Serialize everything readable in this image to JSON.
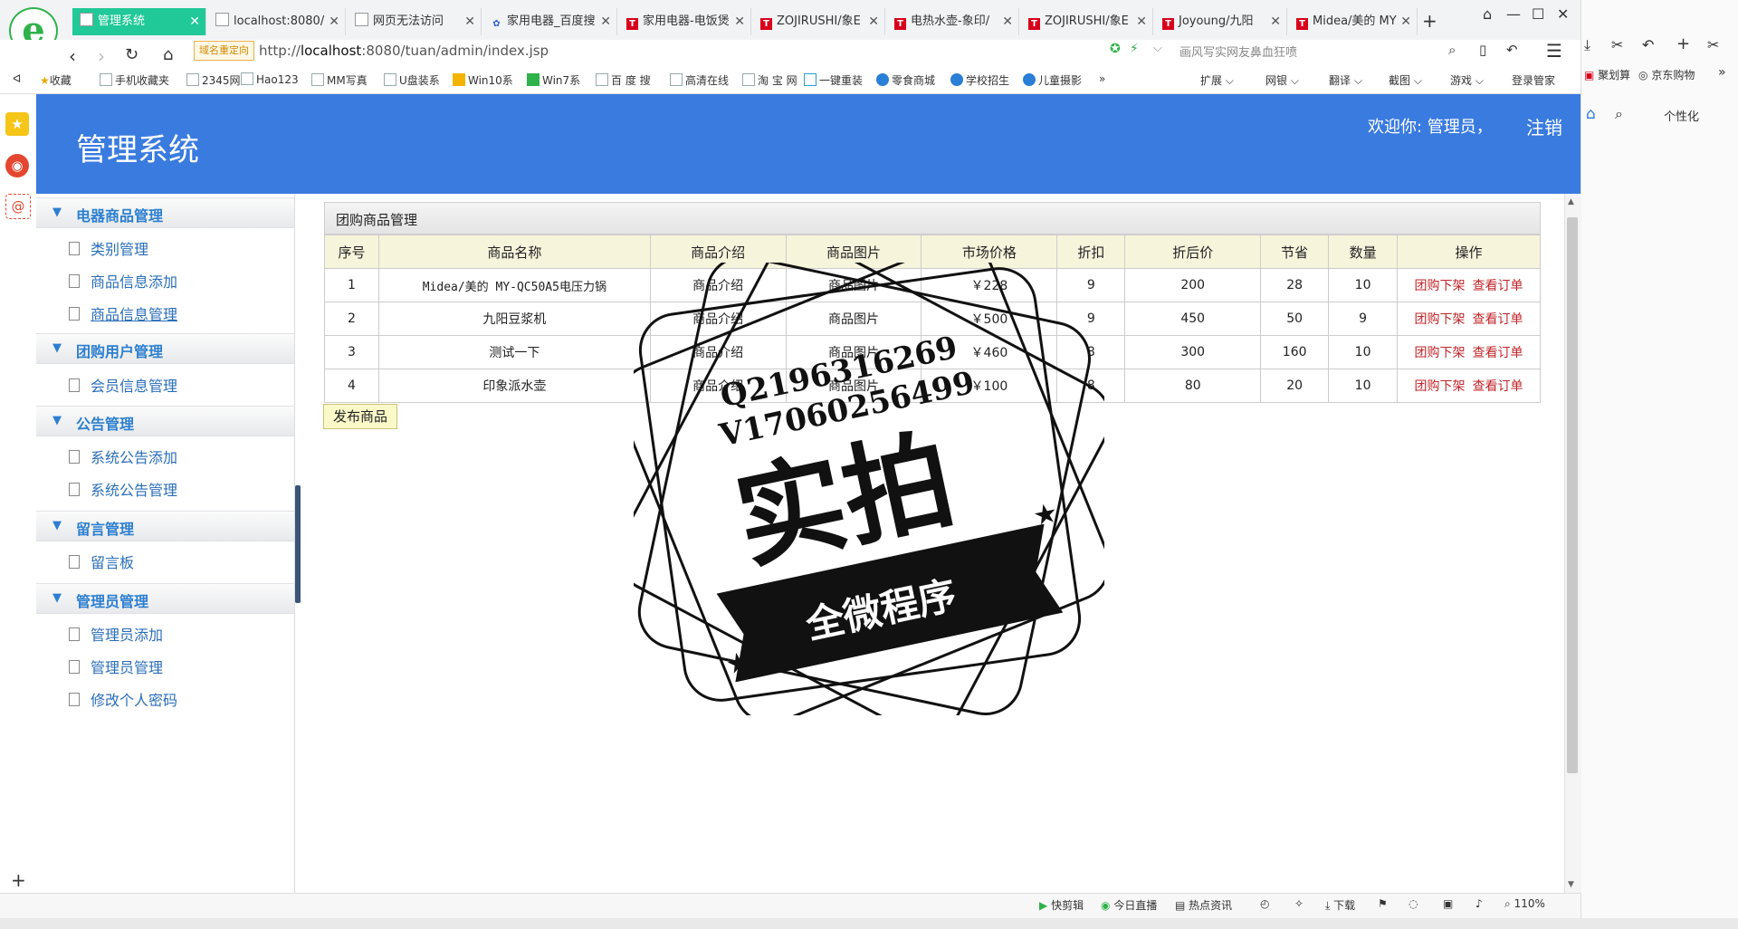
{
  "browser": {
    "tabs": [
      {
        "label": "管理系统",
        "active": true,
        "icon": "page-icon"
      },
      {
        "label": "localhost:8080/",
        "icon": "page-icon"
      },
      {
        "label": "网页无法访问",
        "icon": "page-icon"
      },
      {
        "label": "家用电器_百度搜",
        "icon": "baidu-icon"
      },
      {
        "label": "家用电器-电饭煲",
        "icon": "tmall-icon"
      },
      {
        "label": "ZOJIRUSHI/象E",
        "icon": "tmall-icon"
      },
      {
        "label": "电热水壶-象印/",
        "icon": "tmall-icon"
      },
      {
        "label": "ZOJIRUSHI/象E",
        "icon": "tmall-icon"
      },
      {
        "label": "Joyoung/九阳 ",
        "icon": "tmall-icon"
      },
      {
        "label": "Midea/美的 MY",
        "icon": "tmall-icon"
      }
    ],
    "redirect_badge": "域名重定向",
    "url_prefix": "http://",
    "url_host": "localhost",
    "url_rest": ":8080/tuan/admin/index.jsp",
    "search_placeholder": "画风写实网友鼻血狂喷",
    "bookmarks": [
      "收藏",
      "手机收藏夹",
      "2345网",
      "Hao123",
      "MM写真",
      "U盘装系",
      "Win10系",
      "Win7系",
      "百 度 搜",
      "高清在线",
      "淘 宝 网",
      "一键重装",
      "零食商城",
      "学校招生",
      "儿童摄影"
    ],
    "bookmark_tools": [
      "扩展",
      "网银",
      "翻译",
      "截图",
      "游戏",
      "登录管家"
    ],
    "right_panel": {
      "items": [
        "聚划算",
        "京东购物"
      ],
      "personalize": "个性化"
    },
    "status_items": [
      "快剪辑",
      "今日直播",
      "热点资讯",
      "下载"
    ],
    "zoom": "110%"
  },
  "app": {
    "title": "管理系统",
    "welcome": "欢迎你: 管理员，",
    "logout": "注销",
    "sidebar": [
      {
        "title": "电器商品管理",
        "items": [
          "类别管理",
          "商品信息添加",
          "商品信息管理"
        ]
      },
      {
        "title": "团购用户管理",
        "items": [
          "会员信息管理"
        ]
      },
      {
        "title": "公告管理",
        "items": [
          "系统公告添加",
          "系统公告管理"
        ]
      },
      {
        "title": "留言管理",
        "items": [
          "留言板"
        ]
      },
      {
        "title": "管理员管理",
        "items": [
          "管理员添加",
          "管理员管理",
          "修改个人密码"
        ]
      }
    ],
    "panel_title": "团购商品管理",
    "table": {
      "headers": [
        "序号",
        "商品名称",
        "商品介绍",
        "商品图片",
        "市场价格",
        "折扣",
        "折后价",
        "节省",
        "数量",
        "操作"
      ],
      "rows": [
        [
          "1",
          "Midea/美的 MY-QC50A5电压力锅",
          "商品介绍",
          "商品图片",
          "￥228",
          "9",
          "200",
          "28",
          "10"
        ],
        [
          "2",
          "九阳豆浆机",
          "商品介绍",
          "商品图片",
          "￥500",
          "9",
          "450",
          "50",
          "9"
        ],
        [
          "3",
          "测试一下",
          "商品介绍",
          "商品图片",
          "￥460",
          "8",
          "300",
          "160",
          "10"
        ],
        [
          "4",
          "印象派水壶",
          "商品介绍",
          "商品图片",
          "￥100",
          "8",
          "80",
          "20",
          "10"
        ]
      ],
      "op_offline": "团购下架",
      "op_orders": "查看订单"
    },
    "publish_button": "发布商品"
  },
  "watermark": {
    "line1": "Q2196316269",
    "line2": "V17060256499",
    "big": "实拍",
    "ribbon": "全微程序"
  }
}
